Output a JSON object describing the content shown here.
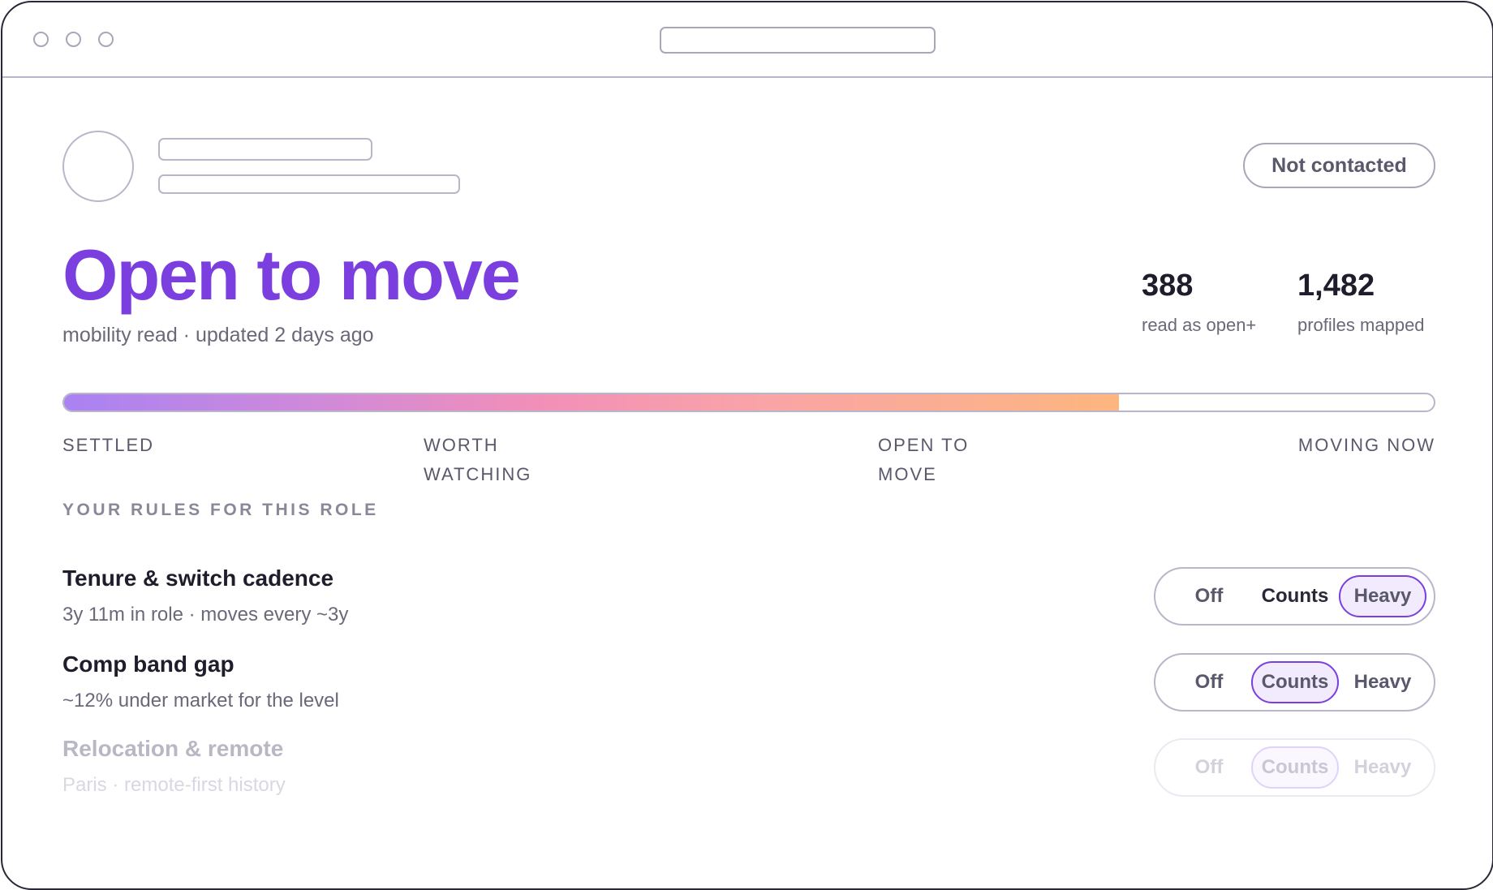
{
  "window": {
    "url_placeholder": ""
  },
  "profile": {
    "status_badge": "Not contacted"
  },
  "mobility": {
    "headline": "Open to move",
    "subline": "mobility read · updated 2 days ago",
    "meter_fraction": 0.77,
    "scale_labels": [
      "SETTLED",
      "WORTH WATCHING",
      "OPEN TO MOVE",
      "MOVING NOW"
    ]
  },
  "stats": [
    {
      "value": "388",
      "label": "read as open+"
    },
    {
      "value": "1,482",
      "label": "profiles mapped"
    }
  ],
  "rules": {
    "heading": "YOUR RULES FOR THIS ROLE",
    "options": [
      "Off",
      "Counts",
      "Heavy"
    ],
    "items": [
      {
        "name": "Tenure & switch cadence",
        "detail": "3y 11m in role · moves every ~3y",
        "selected": "Heavy"
      },
      {
        "name": "Comp band gap",
        "detail": "~12% under market for the level",
        "selected": "Counts"
      },
      {
        "name": "Relocation & remote",
        "detail": "Paris · remote-first history",
        "selected": "Counts",
        "faded": true
      }
    ]
  },
  "colors": {
    "accent": "#7b3fe0",
    "meter_gradient": [
      "#a982f2",
      "#f28fb8",
      "#fdb77e"
    ]
  }
}
